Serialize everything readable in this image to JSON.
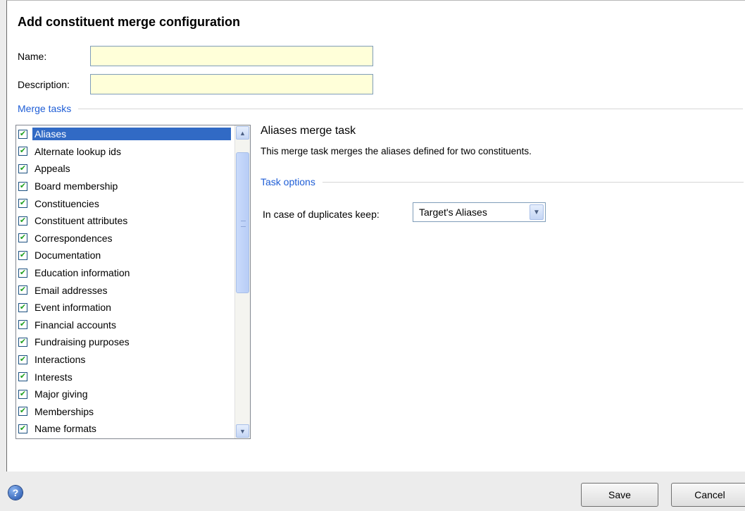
{
  "dialog": {
    "title": "Add constituent merge configuration"
  },
  "form": {
    "name_label": "Name:",
    "name_value": "",
    "description_label": "Description:",
    "description_value": ""
  },
  "merge_tasks": {
    "section_label": "Merge tasks",
    "items": [
      {
        "label": "Aliases",
        "checked": true,
        "selected": true
      },
      {
        "label": "Alternate lookup ids",
        "checked": true
      },
      {
        "label": "Appeals",
        "checked": true
      },
      {
        "label": "Board membership",
        "checked": true
      },
      {
        "label": "Constituencies",
        "checked": true
      },
      {
        "label": "Constituent attributes",
        "checked": true
      },
      {
        "label": "Correspondences",
        "checked": true
      },
      {
        "label": "Documentation",
        "checked": true
      },
      {
        "label": "Education information",
        "checked": true
      },
      {
        "label": "Email addresses",
        "checked": true
      },
      {
        "label": "Event information",
        "checked": true
      },
      {
        "label": "Financial accounts",
        "checked": true
      },
      {
        "label": "Fundraising purposes",
        "checked": true
      },
      {
        "label": "Interactions",
        "checked": true
      },
      {
        "label": "Interests",
        "checked": true
      },
      {
        "label": "Major giving",
        "checked": true
      },
      {
        "label": "Memberships",
        "checked": true
      },
      {
        "label": "Name formats",
        "checked": true
      }
    ]
  },
  "task_detail": {
    "title": "Aliases merge task",
    "description": "This merge task merges the aliases defined for two constituents.",
    "options_section_label": "Task options",
    "duplicates_label": "In case of duplicates keep:",
    "duplicates_value": "Target's Aliases"
  },
  "footer": {
    "save_label": "Save",
    "cancel_label": "Cancel"
  },
  "colors": {
    "accent": "#1f5ed6",
    "selection": "#316ac5",
    "input_bg": "#ffffd9"
  }
}
